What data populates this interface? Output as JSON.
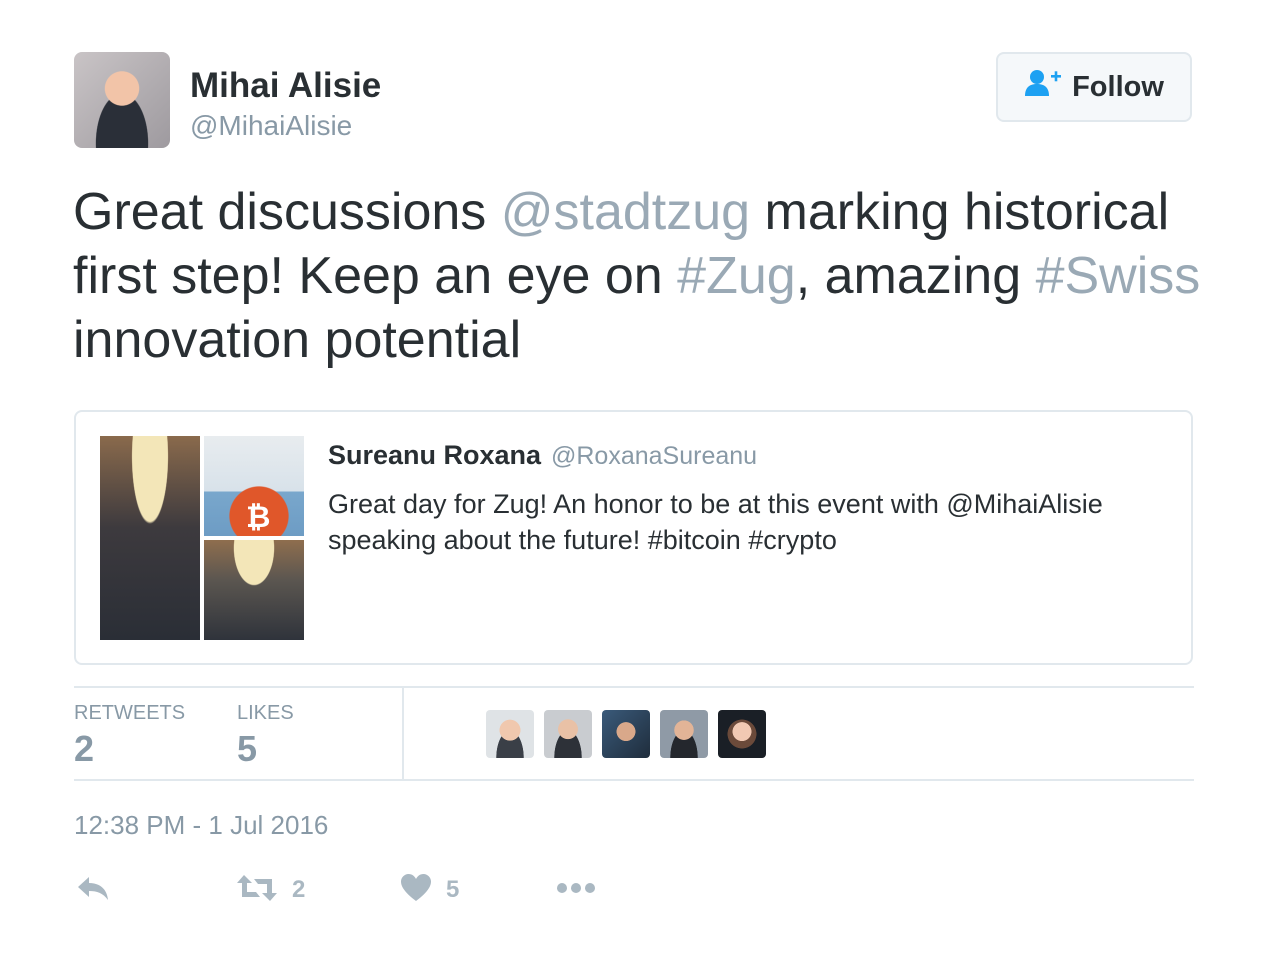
{
  "author": {
    "name": "Mihai Alisie",
    "handle": "@MihaiAlisie"
  },
  "follow_button": {
    "label": "Follow",
    "icon": "follow-user-icon"
  },
  "tweet": {
    "segments": [
      "Great discussions ",
      "@stadtzug",
      " marking historical first step! Keep an eye on ",
      "#Zug",
      ", amazing ",
      "#Swiss",
      " innovation potential"
    ]
  },
  "quote": {
    "name": "Sureanu Roxana",
    "handle": "@RoxanaSureanu",
    "text": "Great day for Zug! An honor to be at this event with @MihaiAlisie speaking about the future! #bitcoin #crypto"
  },
  "stats": {
    "retweets_label": "RETWEETS",
    "retweets": "2",
    "likes_label": "LIKES",
    "likes": "5"
  },
  "timestamp": "12:38 PM - 1 Jul 2016",
  "actions": {
    "retweet_count": "2",
    "like_count": "5"
  },
  "colors": {
    "text": "#292f33",
    "muted": "#8899a6",
    "entity": "#9aa9b5",
    "border": "#e1e8ed"
  }
}
